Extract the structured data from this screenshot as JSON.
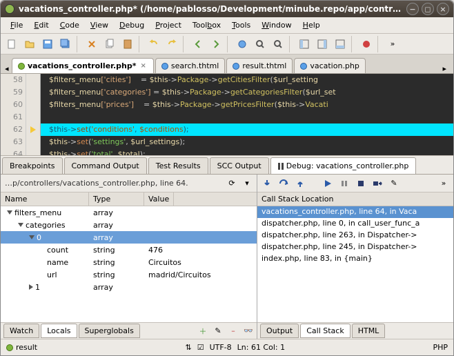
{
  "window": {
    "title": "vacations_controller.php* (/home/pablosso/Development/minube.repo/app/contr…"
  },
  "menu": {
    "items": [
      "File",
      "Edit",
      "Code",
      "View",
      "Debug",
      "Project",
      "Toolbox",
      "Tools",
      "Window",
      "Help"
    ]
  },
  "file_tabs": [
    {
      "label": "vacations_controller.php*",
      "active": true,
      "modified": true
    },
    {
      "label": "search.thtml",
      "active": false,
      "modified": false
    },
    {
      "label": "result.thtml",
      "active": false,
      "modified": false
    },
    {
      "label": "vacation.php",
      "active": false,
      "modified": false
    }
  ],
  "code": {
    "lines": [
      58,
      59,
      60,
      61,
      62,
      63,
      64
    ],
    "breakpoint_line": 62,
    "text": {
      "l58": {
        "a": "$filters_menu",
        "b": "['cities']",
        "c": "    = ",
        "d": "$this",
        "e": "->",
        "f": "Package",
        "g": "->",
        "h": "getCitiesFilter",
        "i": "(",
        "j": "$url_setting"
      },
      "l59": {
        "a": "$filters_menu",
        "b": "['categories']",
        "c": " = ",
        "d": "$this",
        "e": "->",
        "f": "Package",
        "g": "->",
        "h": "getCategoriesFilter",
        "i": "(",
        "j": "$url_set"
      },
      "l60": {
        "a": "$filters_menu",
        "b": "['prices']",
        "c": "    = ",
        "d": "$this",
        "e": "->",
        "f": "Package",
        "g": "->",
        "h": "getPricesFilter",
        "i": "(",
        "j": "$this",
        "k": "->",
        "l": "Vacati"
      },
      "l62": {
        "a": "$this",
        "b": "->",
        "c": "set",
        "d": "(",
        "e": "'conditions'",
        "f": ", ",
        "g": "$conditions",
        "h": ");"
      },
      "l63": {
        "a": "$this",
        "b": "->",
        "c": "set",
        "d": "(",
        "e": "'settings'",
        "f": ", ",
        "g": "$url_settings",
        "h": ");"
      },
      "l64": {
        "a": "$this",
        "b": "->",
        "c": "set",
        "d": "(",
        "e": "'total'",
        "f": ", ",
        "g": "$total",
        "h": ");"
      }
    }
  },
  "panel_tabs": {
    "items": [
      "Breakpoints",
      "Command Output",
      "Test Results",
      "SCC Output"
    ],
    "debug_tab": "Debug: vacations_controller.php"
  },
  "left_panel": {
    "context": "…p/controllers/vacations_controller.php, line 64.",
    "columns": {
      "name": "Name",
      "type": "Type",
      "value": "Value"
    },
    "rows": [
      {
        "indent": 0,
        "expand": "down",
        "name": "filters_menu",
        "type": "array",
        "value": ""
      },
      {
        "indent": 1,
        "expand": "down",
        "name": "categories",
        "type": "array",
        "value": ""
      },
      {
        "indent": 2,
        "expand": "down",
        "name": "0",
        "type": "array",
        "value": "",
        "selected": true
      },
      {
        "indent": 3,
        "expand": "",
        "name": "count",
        "type": "string",
        "value": "476"
      },
      {
        "indent": 3,
        "expand": "",
        "name": "name",
        "type": "string",
        "value": "Circuitos"
      },
      {
        "indent": 3,
        "expand": "",
        "name": "url",
        "type": "string",
        "value": "madrid/Circuitos"
      },
      {
        "indent": 2,
        "expand": "right",
        "name": "1",
        "type": "array",
        "value": ""
      }
    ],
    "bottom_tabs": [
      "Watch",
      "Locals",
      "Superglobals"
    ],
    "bottom_active": 1
  },
  "right_panel": {
    "header": "Call Stack Location",
    "rows": [
      {
        "text": "vacations_controller.php, line 64, in Vaca",
        "selected": true
      },
      {
        "text": "dispatcher.php, line 0, in call_user_func_a"
      },
      {
        "text": "dispatcher.php, line 263, in Dispatcher->"
      },
      {
        "text": "dispatcher.php, line 245, in Dispatcher->"
      },
      {
        "text": "index.php, line 83, in {main}"
      }
    ],
    "bottom_tabs": [
      "Output",
      "Call Stack",
      "HTML"
    ],
    "bottom_active": 1
  },
  "status": {
    "file": "result",
    "encoding": "UTF-8",
    "position": "Ln: 61 Col: 1",
    "lang": "PHP"
  }
}
